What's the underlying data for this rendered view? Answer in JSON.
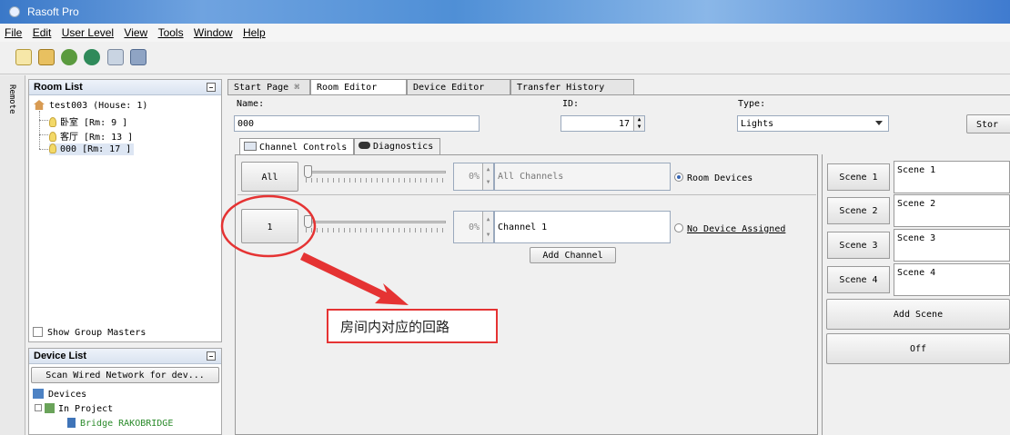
{
  "window": {
    "title": "Rasoft Pro"
  },
  "menu": [
    "File",
    "Edit",
    "User Level",
    "View",
    "Tools",
    "Window",
    "Help"
  ],
  "toolbar_icons": [
    "new-project-icon",
    "open-folder-icon",
    "import-icon",
    "network-icon",
    "add-device-icon",
    "save-icon"
  ],
  "side_strip": {
    "label": "Remote"
  },
  "room_list": {
    "title": "Room List",
    "house": "test003 (House: 1)",
    "rooms": [
      {
        "label": "卧室 [Rm: 9 ]"
      },
      {
        "label": "客厅 [Rm: 13 ]"
      },
      {
        "label": "000 [Rm: 17 ]"
      }
    ],
    "show_group_masters": "Show Group Masters"
  },
  "device_list": {
    "title": "Device List",
    "scan_button": "Scan Wired Network for dev...",
    "devices": "Devices",
    "in_project": "In Project",
    "bridge": "Bridge RAKOBRIDGE"
  },
  "tabs": [
    {
      "label": "Start Page"
    },
    {
      "label": "Room Editor"
    },
    {
      "label": "Device Editor"
    },
    {
      "label": "Transfer History"
    }
  ],
  "room_editor": {
    "name_label": "Name:",
    "name_value": "000",
    "id_label": "ID:",
    "id_value": "17",
    "type_label": "Type:",
    "type_value": "Lights",
    "store_button": "Stor",
    "subtabs": [
      {
        "label": "Channel Controls"
      },
      {
        "label": "Diagnostics"
      }
    ],
    "all_button": "All",
    "all_percent": "0%",
    "all_channels_label": "All Channels",
    "room_devices_label": "Room Devices",
    "channel_button": "1",
    "channel_percent": "0%",
    "channel_name": "Channel 1",
    "no_device_label": "No Device Assigned",
    "add_channel_button": "Add Channel",
    "scenes": [
      {
        "button": "Scene 1",
        "name": "Scene 1"
      },
      {
        "button": "Scene 2",
        "name": "Scene 2"
      },
      {
        "button": "Scene 3",
        "name": "Scene 3"
      },
      {
        "button": "Scene 4",
        "name": "Scene 4"
      }
    ],
    "add_scene_button": "Add Scene",
    "off_button": "Off"
  },
  "annotation": {
    "text": "房间内对应的回路"
  }
}
